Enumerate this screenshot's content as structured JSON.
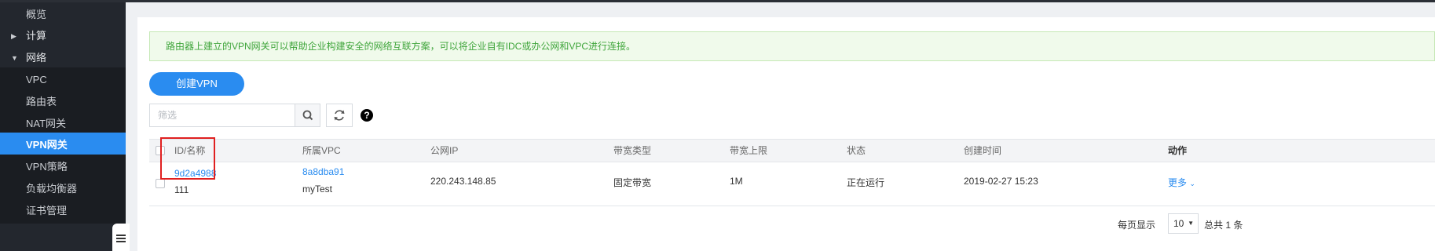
{
  "sidebar": {
    "items": [
      {
        "label": "概览"
      },
      {
        "label": "计算"
      },
      {
        "label": "网络"
      },
      {
        "label": "VPC"
      },
      {
        "label": "路由表"
      },
      {
        "label": "NAT网关"
      },
      {
        "label": "VPN网关"
      },
      {
        "label": "VPN策略"
      },
      {
        "label": "负载均衡器"
      },
      {
        "label": "证书管理"
      }
    ]
  },
  "notice": {
    "text": "路由器上建立的VPN网关可以帮助企业构建安全的网络互联方案，可以将企业自有IDC或办公网和VPC进行连接。"
  },
  "toolbar": {
    "create_label": "创建VPN",
    "filter_placeholder": "筛选",
    "help_glyph": "?"
  },
  "table": {
    "headers": [
      "ID/名称",
      "所属VPC",
      "公网IP",
      "带宽类型",
      "带宽上限",
      "状态",
      "创建时间",
      "动作"
    ],
    "rows": [
      {
        "id": "9d2a4988",
        "name": "111",
        "vpc_id": "8a8dba91",
        "vpc_name": "myTest",
        "public_ip": "220.243.148.85",
        "bandwidth_type": "固定带宽",
        "bandwidth_limit": "1M",
        "status": "正在运行",
        "created": "2019-02-27 15:23",
        "action": "更多"
      }
    ]
  },
  "pager": {
    "per_page_label": "每页显示",
    "page_size": "10",
    "total_label": "总共 1 条"
  },
  "colors": {
    "accent": "#2a8cf0",
    "sidebar_bg": "#23272e",
    "notice_text": "#3fa53b",
    "highlight": "#e02020"
  }
}
